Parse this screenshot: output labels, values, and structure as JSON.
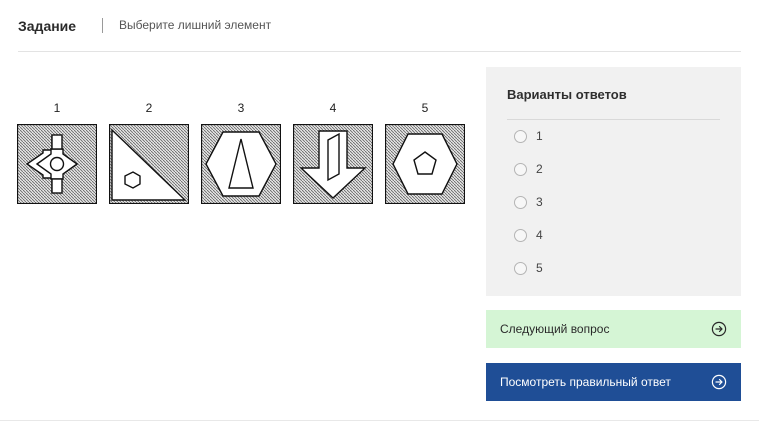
{
  "header": {
    "title": "Задание",
    "subtitle": "Выберите лишний элемент"
  },
  "figures": [
    {
      "number": "1",
      "icon": "diamond-arrows-circle"
    },
    {
      "number": "2",
      "icon": "triangle-hexagon"
    },
    {
      "number": "3",
      "icon": "hexagon-triangle"
    },
    {
      "number": "4",
      "icon": "arrow-down-parallelogram"
    },
    {
      "number": "5",
      "icon": "hexagon-pentagon"
    }
  ],
  "answers": {
    "title": "Варианты ответов",
    "options": [
      "1",
      "2",
      "3",
      "4",
      "5"
    ]
  },
  "buttons": {
    "next": "Следующий вопрос",
    "show_answer": "Посмотреть правильный ответ"
  },
  "colors": {
    "next_bg": "#d5f5d5",
    "show_bg": "#1f4e96",
    "panel_bg": "#f1f1f1"
  }
}
